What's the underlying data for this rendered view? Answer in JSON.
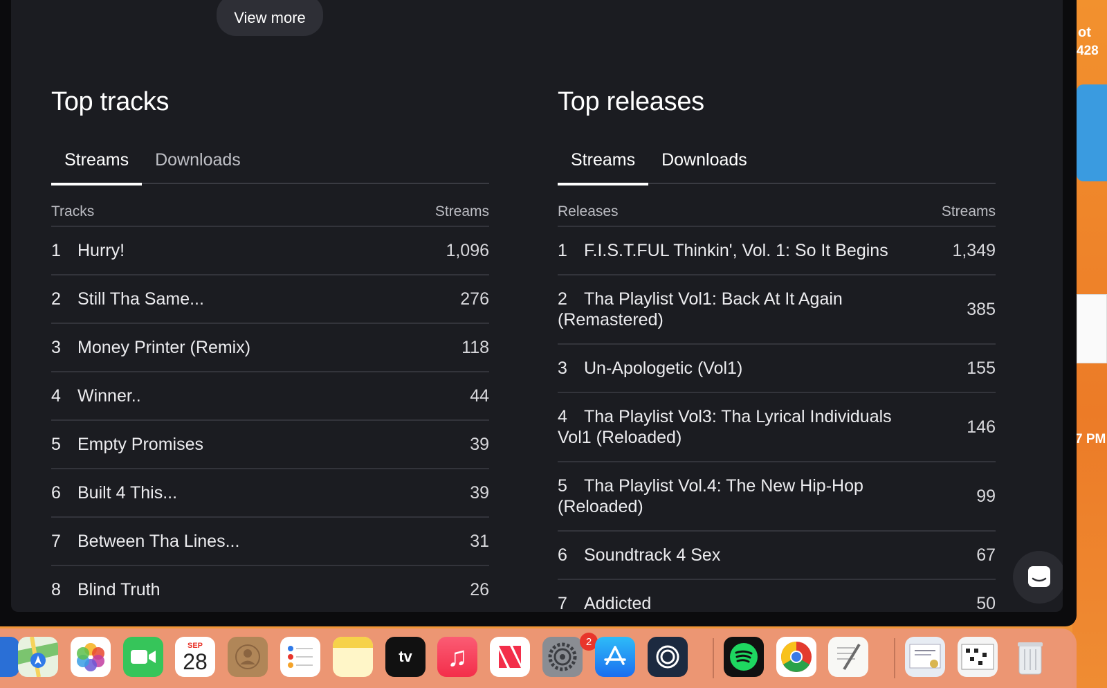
{
  "view_more_label": "View more",
  "top_tracks": {
    "title": "Top tracks",
    "tabs": [
      {
        "label": "Streams",
        "active": true
      },
      {
        "label": "Downloads",
        "active": false
      }
    ],
    "columns": {
      "name": "Tracks",
      "value": "Streams"
    },
    "rows": [
      {
        "rank": "1",
        "name": "Hurry!",
        "value": "1,096"
      },
      {
        "rank": "2",
        "name": "Still Tha Same...",
        "value": "276"
      },
      {
        "rank": "3",
        "name": "Money Printer (Remix)",
        "value": "118"
      },
      {
        "rank": "4",
        "name": "Winner..",
        "value": "44"
      },
      {
        "rank": "5",
        "name": "Empty Promises",
        "value": "39"
      },
      {
        "rank": "6",
        "name": "Built 4 This...",
        "value": "39"
      },
      {
        "rank": "7",
        "name": "Between Tha Lines...",
        "value": "31"
      },
      {
        "rank": "8",
        "name": "Blind Truth",
        "value": "26"
      }
    ]
  },
  "top_releases": {
    "title": "Top releases",
    "tabs": [
      {
        "label": "Streams",
        "active": true
      },
      {
        "label": "Downloads",
        "active": false
      }
    ],
    "columns": {
      "name": "Releases",
      "value": "Streams"
    },
    "rows": [
      {
        "rank": "1",
        "name": "F.I.S.T.FUL Thinkin', Vol. 1: So It Begins",
        "value": "1,349"
      },
      {
        "rank": "2",
        "name": "Tha Playlist Vol1: Back At It Again (Remastered)",
        "value": "385"
      },
      {
        "rank": "3",
        "name": "Un-Apologetic (Vol1)",
        "value": "155"
      },
      {
        "rank": "4",
        "name": "Tha Playlist Vol3: Tha Lyrical Individuals Vol1 (Reloaded)",
        "value": "146"
      },
      {
        "rank": "5",
        "name": "Tha Playlist Vol.4: The New Hip-Hop (Reloaded)",
        "value": "99"
      },
      {
        "rank": "6",
        "name": "Soundtrack 4 Sex",
        "value": "67"
      },
      {
        "rank": "7",
        "name": "Addicted",
        "value": "50"
      }
    ]
  },
  "desktop": {
    "label_top": "ot",
    "label_numbers": "428",
    "clock_fragment": "7 PM"
  },
  "dock": {
    "calendar_month": "SEP",
    "calendar_day": "28",
    "settings_badge": "2",
    "apps": [
      "maps-icon",
      "photos-icon",
      "facetime-icon",
      "calendar-icon",
      "contacts-icon",
      "reminders-icon",
      "notes-icon",
      "appletv-icon",
      "music-icon",
      "news-icon",
      "settings-icon",
      "appstore-icon",
      "onepassword-icon",
      "spotify-icon",
      "chrome-icon",
      "textedit-icon",
      "certificate-icon",
      "crossword-icon",
      "trash-icon"
    ]
  },
  "colors": {
    "window_bg": "#1b1c21",
    "text": "#ececef",
    "divider": "#33343b",
    "desktop_orange": "#ee7a28"
  }
}
